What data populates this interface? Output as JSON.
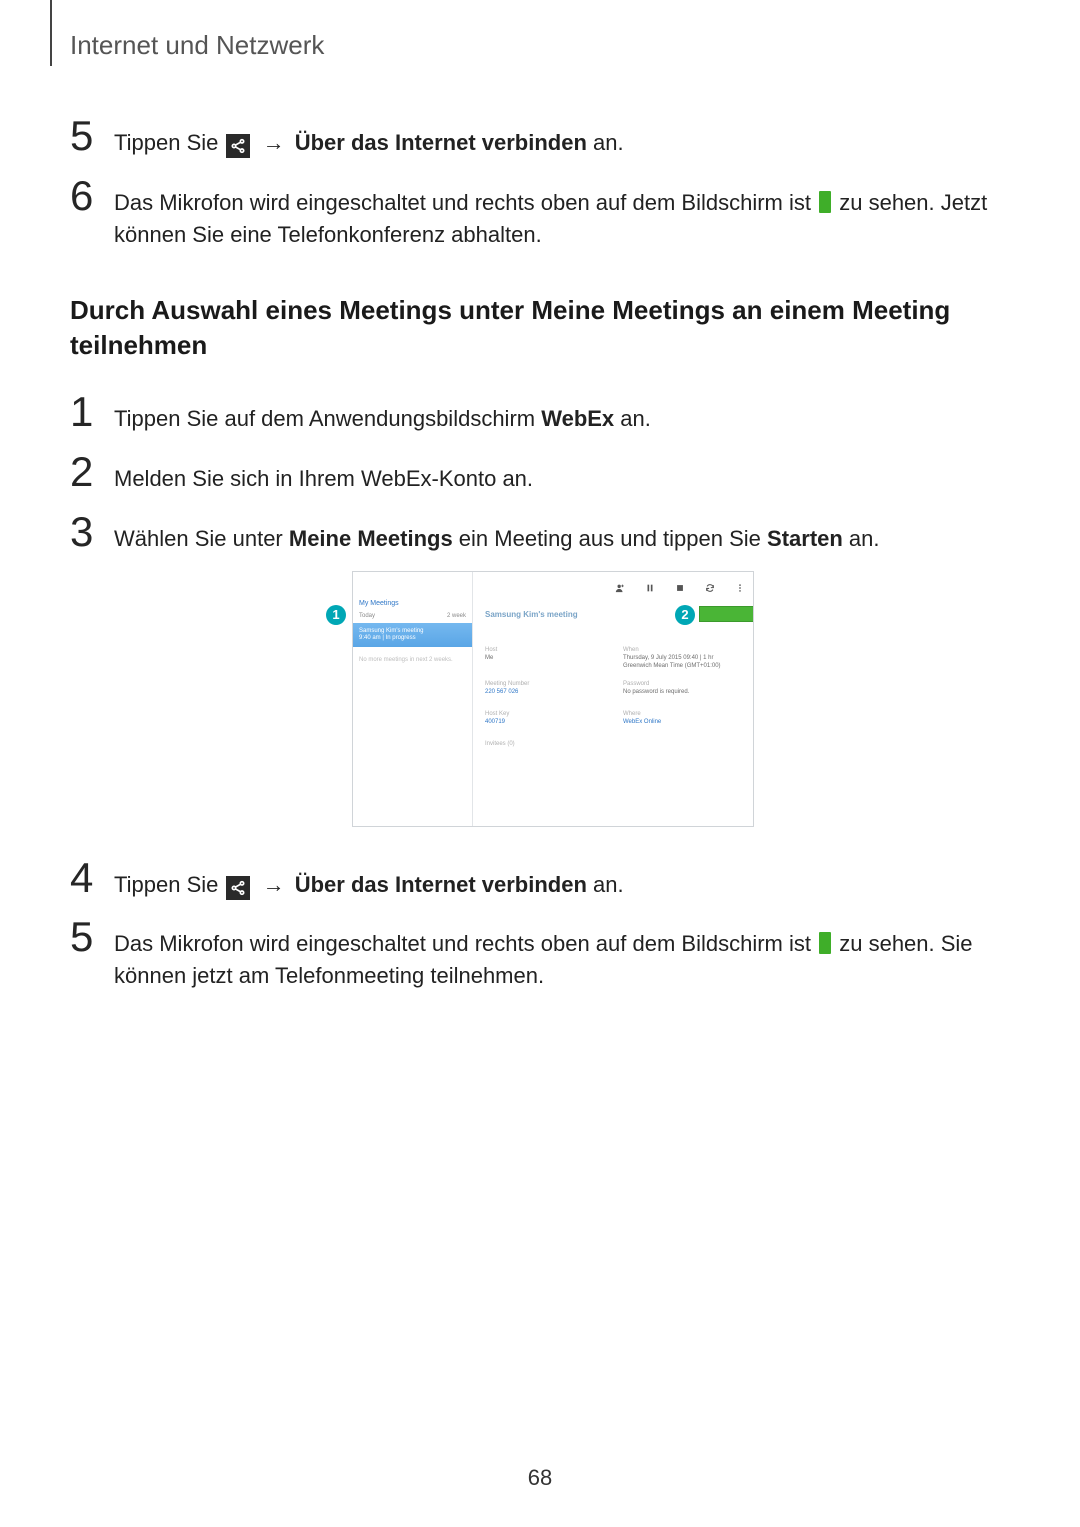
{
  "header": "Internet und Netzwerk",
  "steps_top": {
    "s5": {
      "tippen_sie": "Tippen Sie ",
      "arrow": " → ",
      "bold": "Über das Internet verbinden",
      "an": " an."
    },
    "s6": {
      "p1": "Das Mikrofon wird eingeschaltet und rechts oben auf dem Bildschirm ist ",
      "p2": " zu sehen. Jetzt können Sie eine Telefonkonferenz abhalten."
    }
  },
  "subheading": "Durch Auswahl eines Meetings unter Meine Meetings an einem Meeting teilnehmen",
  "steps_mid": {
    "s1": {
      "t1": "Tippen Sie auf dem Anwendungsbildschirm ",
      "b": "WebEx",
      "t2": " an."
    },
    "s2": {
      "t": "Melden Sie sich in Ihrem WebEx-Konto an."
    },
    "s3": {
      "t1": "Wählen Sie unter ",
      "b1": "Meine Meetings",
      "t2": " ein Meeting aus und tippen Sie ",
      "b2": "Starten",
      "t3": " an."
    }
  },
  "steps_bot": {
    "s4": {
      "tippen_sie": "Tippen Sie ",
      "arrow": " → ",
      "bold": "Über das Internet verbinden",
      "an": " an."
    },
    "s5": {
      "p1": "Das Mikrofon wird eingeschaltet und rechts oben auf dem Bildschirm ist ",
      "p2": " zu sehen. Sie können jetzt am Telefonmeeting teilnehmen."
    }
  },
  "callouts": {
    "one": "1",
    "two": "2"
  },
  "shot": {
    "mymeetings": "My Meetings",
    "filter_today": "Today",
    "filter_range": "2 week",
    "sel_line1": "Samsung Kim's meeting",
    "sel_line2": "9:40 am | In progress",
    "nomore": "No more meetings in next 2 weeks.",
    "detail_title": "Samsung Kim's meeting",
    "host_lbl": "Host",
    "host_val": "Me",
    "when_lbl": "When",
    "when_val1": "Thursday, 9 July 2015 09:40  |  1 hr",
    "when_val2": "Greenwich Mean Time (GMT+01:00)",
    "num_lbl": "Meeting Number",
    "num_val": "220 567 026",
    "pass_lbl": "Password",
    "pass_val": "No password is required.",
    "hkey_lbl": "Host Key",
    "hkey_val": "400719",
    "where_lbl": "Where",
    "where_val": "WebEx Online",
    "invitees_lbl": "Invitees (0)"
  },
  "page_num": "68"
}
